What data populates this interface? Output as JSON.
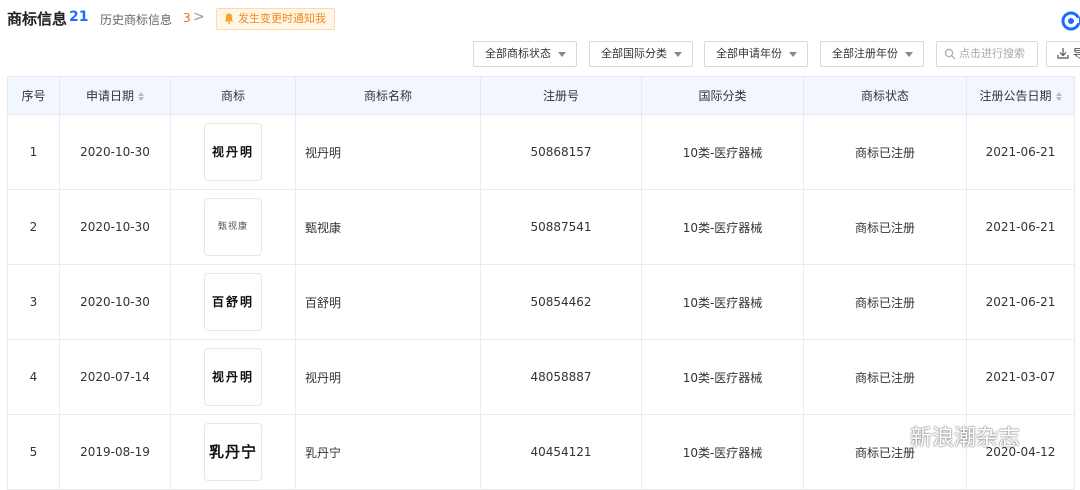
{
  "header": {
    "title": "商标信息",
    "count": "21",
    "history_label": "历史商标信息",
    "history_count": "3",
    "history_arrow": ">",
    "notify_label": "发生变更时通知我"
  },
  "filters": [
    {
      "label": "全部商标状态"
    },
    {
      "label": "全部国际分类"
    },
    {
      "label": "全部申请年份"
    },
    {
      "label": "全部注册年份"
    }
  ],
  "search": {
    "placeholder": "点击进行搜索"
  },
  "export": {
    "label": "导"
  },
  "table": {
    "columns": [
      "序号",
      "申请日期",
      "商标",
      "商标名称",
      "注册号",
      "国际分类",
      "商标状态",
      "注册公告日期"
    ],
    "rows": [
      {
        "no": "1",
        "apply_date": "2020-10-30",
        "mark_text": "视丹明",
        "name": "视丹明",
        "reg_no": "50868157",
        "class": "10类-医疗器械",
        "status": "商标已注册",
        "pub_date": "2021-06-21"
      },
      {
        "no": "2",
        "apply_date": "2020-10-30",
        "mark_text": "甄视康",
        "name": "甄视康",
        "reg_no": "50887541",
        "class": "10类-医疗器械",
        "status": "商标已注册",
        "pub_date": "2021-06-21"
      },
      {
        "no": "3",
        "apply_date": "2020-10-30",
        "mark_text": "百舒明",
        "name": "百舒明",
        "reg_no": "50854462",
        "class": "10类-医疗器械",
        "status": "商标已注册",
        "pub_date": "2021-06-21"
      },
      {
        "no": "4",
        "apply_date": "2020-07-14",
        "mark_text": "视丹明",
        "name": "视丹明",
        "reg_no": "48058887",
        "class": "10类-医疗器械",
        "status": "商标已注册",
        "pub_date": "2021-03-07"
      },
      {
        "no": "5",
        "apply_date": "2019-08-19",
        "mark_text": "乳丹宁",
        "name": "乳丹宁",
        "reg_no": "40454121",
        "class": "10类-医疗器械",
        "status": "商标已注册",
        "pub_date": "2020-04-12"
      }
    ]
  },
  "watermark": {
    "text": "新浪潮杂志"
  },
  "colors": {
    "accent": "#1a6dff",
    "warning": "#f06c16",
    "header_bg": "#f2f7ff"
  }
}
